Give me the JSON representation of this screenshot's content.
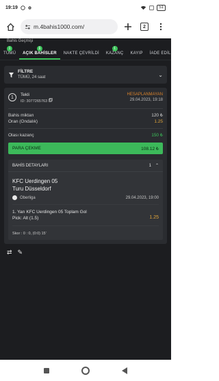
{
  "status_bar": {
    "time": "19:19",
    "left_icons": [
      "messenger-icon",
      "settings-icon"
    ],
    "right_icons": [
      "wifi-icon",
      "sim-icon"
    ],
    "battery": "51"
  },
  "browser": {
    "url": "m.4bahis1000.com/",
    "tab_count": "2"
  },
  "app": {
    "top_strip": "Bahis Geçmişi",
    "tabs": [
      {
        "label": "TÜMÜ",
        "badge": "1"
      },
      {
        "label": "AÇIK BAHİSLER",
        "badge": "1",
        "active": true
      },
      {
        "label": "NAKTE ÇEVRİLDİ",
        "badge": ""
      },
      {
        "label": "KAZANÇ",
        "badge": "1"
      },
      {
        "label": "KAYIP",
        "badge": ""
      },
      {
        "label": "İADE EDİL",
        "badge": ""
      }
    ],
    "filter": {
      "title": "FİLTRE",
      "subtitle": "TÜMÜ, 24 saat"
    },
    "bet": {
      "number": "1",
      "type": "Tekli",
      "id": "ID: 3077265763",
      "status": "HESAPLANMAYAN",
      "date": "29.04.2023, 19:18",
      "stake_label": "Bahis miktarı",
      "stake_value": "120 ₺",
      "odds_label": "Oran (Ondalık)",
      "odds_value": "1.25",
      "potential_label": "Olası kazanç",
      "potential_value": "150 ₺",
      "cashout_label": "PARA ÇEKME",
      "cashout_value": "108.12 ₺",
      "details": {
        "title": "BAHİS DETAYLARI",
        "count": "1",
        "team_home": "KFC Uerdingen 05",
        "team_away": "Turu Düsseldorf",
        "league": "Oberliga",
        "match_date": "29.04.2023, 19:00",
        "market": "1. Yarı KFC Uerdingen 05 Toplam Gol",
        "pick": "Pick: Alt (1.5)",
        "odd": "1.25",
        "score": "Skor : 0 : 0, (0:0) 15'"
      }
    }
  },
  "colors": {
    "accent": "#3cc35a",
    "background": "#1c1d20",
    "card": "#2a2c30",
    "orange": "#e0a43a"
  }
}
